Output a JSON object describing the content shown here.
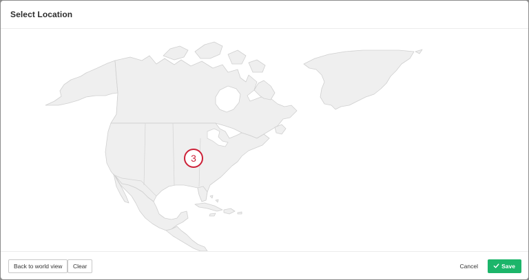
{
  "dialog": {
    "title": "Select Location"
  },
  "map": {
    "land_color": "#efefef",
    "border_color": "#cfcfcf",
    "marker": {
      "label": "3",
      "color": "#cc1f36"
    }
  },
  "footer": {
    "back_label": "Back to world view",
    "clear_label": "Clear",
    "cancel_label": "Cancel",
    "save_label": "Save",
    "save_icon": "checkmark-icon",
    "save_color": "#1cb56a"
  }
}
